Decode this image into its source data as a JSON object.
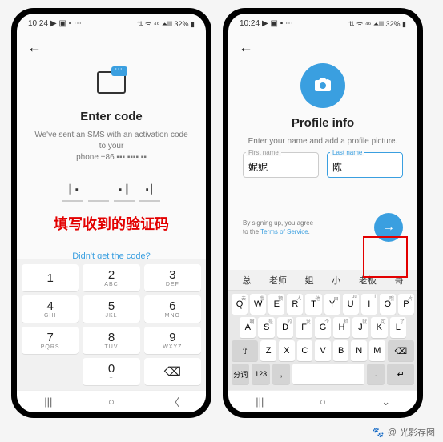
{
  "statusbar": {
    "time": "10:24",
    "icons_left": "▶ ▣ ▪ ⋯",
    "icons_right": "⇅ ᯤ ⁴⁶ ⏶ill 32% ▮"
  },
  "left": {
    "title": "Enter code",
    "sub1": "We've sent an SMS with an activation code to your",
    "sub2": "phone +86 ▪▪▪ ▪▪▪▪ ▪▪",
    "slots": [
      "┃ ▪",
      "",
      "▪ ┃",
      "▪┃"
    ],
    "overlay": "填写收到的验证码",
    "link": "Didn't get the code?",
    "keys": [
      {
        "n": "1",
        "l": ""
      },
      {
        "n": "2",
        "l": "ABC"
      },
      {
        "n": "3",
        "l": "DEF"
      },
      {
        "n": "4",
        "l": "GHI"
      },
      {
        "n": "5",
        "l": "JKL"
      },
      {
        "n": "6",
        "l": "MNO"
      },
      {
        "n": "7",
        "l": "PQRS"
      },
      {
        "n": "8",
        "l": "TUV"
      },
      {
        "n": "9",
        "l": "WXYZ"
      },
      {
        "n": "",
        "l": ""
      },
      {
        "n": "0",
        "l": "+"
      },
      {
        "n": "⌫",
        "l": ""
      }
    ]
  },
  "right": {
    "title": "Profile info",
    "sub": "Enter your name and add a profile picture.",
    "first_label": "First name",
    "first_val": "妮妮",
    "last_label": "Last name",
    "last_val": "陈",
    "terms1": "By signing up, you agree",
    "terms2": "to the ",
    "terms_link": "Terms of Service",
    "suggestions": [
      "总",
      "老师",
      "姐",
      "小",
      "老板",
      "哥"
    ],
    "row1": [
      "Q",
      "W",
      "E",
      "R",
      "T",
      "Y",
      "U",
      "I",
      "O",
      "P"
    ],
    "row1alt": [
      "去",
      "我",
      "额",
      "人",
      "他",
      "由",
      "uu",
      "i",
      "哦",
      "片"
    ],
    "row2": [
      "A",
      "S",
      "D",
      "F",
      "G",
      "H",
      "J",
      "K",
      "L"
    ],
    "row2alt": [
      "啊",
      "是",
      "的",
      "发",
      "个",
      "和",
      "就",
      "可",
      "了"
    ],
    "row3": [
      "Z",
      "X",
      "C",
      "V",
      "B",
      "N",
      "M"
    ],
    "shift": "⇧",
    "bksp": "⌫",
    "fenci": "分词",
    "num": "123",
    "emoji": "☺",
    "comma": ",",
    "period": ".",
    "enter": "↵"
  },
  "colors": {
    "accent": "#3a9fe0",
    "red": "#e30000"
  },
  "watermark": {
    "logo": "🐾",
    "at": "@",
    "name": "光影存图"
  }
}
